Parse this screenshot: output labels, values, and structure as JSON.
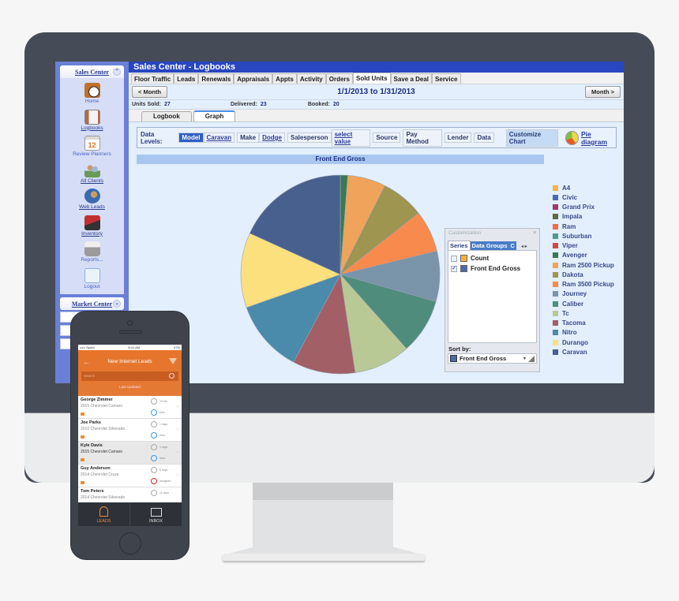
{
  "app": {
    "title": "Sales Center - Logbooks",
    "tabs": [
      "Floor Traffic",
      "Leads",
      "Renewals",
      "Appraisals",
      "Appts",
      "Activity",
      "Orders",
      "Sold Units",
      "Save a Deal",
      "Service"
    ],
    "active_tab": "Sold Units"
  },
  "sidebar": {
    "header": "Sales Center",
    "items": [
      {
        "label": "Home",
        "icon": "clock-calendar-icon",
        "color": "#c0702a"
      },
      {
        "label": "Logbooks",
        "icon": "book-icon",
        "color": "#b06a4a"
      },
      {
        "label": "Review Planners",
        "icon": "calendar-icon",
        "color": "#e7e7e7"
      },
      {
        "label": "All Clients",
        "icon": "people-icon",
        "color": "#6a9a5a"
      },
      {
        "label": "Web Leads",
        "icon": "globe-icon",
        "color": "#3a6ab0"
      },
      {
        "label": "Inventory",
        "icon": "car-icon",
        "color": "#c03030"
      },
      {
        "label": "Reports...",
        "icon": "printer-icon",
        "color": "#9a9a9a"
      },
      {
        "label": "Logout",
        "icon": "key-door-icon",
        "color": "#8ab0e0"
      }
    ],
    "market_header": "Market Center"
  },
  "period": {
    "prev_label": "< Month",
    "next_label": "Month >",
    "range": "1/1/2013 to 1/31/2013"
  },
  "stats": {
    "units_sold_label": "Units Sold:",
    "units_sold": "27",
    "delivered_label": "Delivered:",
    "delivered": "23",
    "booked_label": "Booked:",
    "booked": "20"
  },
  "subtabs": [
    "Logbook",
    "Graph"
  ],
  "active_subtab": "Graph",
  "toolbar": {
    "label": "Data Levels:",
    "model": "Model",
    "model_value": "Caravan",
    "make": "Make",
    "make_value": "Dodge",
    "salesperson": "Salesperson",
    "salesperson_value": "select value",
    "source": "Source",
    "pay_method": "Pay Method",
    "lender": "Lender",
    "data": "Data",
    "customize": "Customize Chart",
    "pie_diagram": "Pie diagram"
  },
  "customization": {
    "title": "Customization",
    "tabs": [
      "Series",
      "Data Groups",
      "C"
    ],
    "series": [
      {
        "label": "Count",
        "checked": false,
        "color": "#f5b041"
      },
      {
        "label": "Front End Gross",
        "checked": true,
        "color": "#4a6aa8"
      }
    ],
    "sort_by_label": "Sort by:",
    "sort_by_value": "Front End Gross"
  },
  "chart_data": {
    "type": "pie",
    "title": "Front End Gross",
    "legend_position": "right",
    "categories": [
      "A4",
      "Civic",
      "Grand Prix",
      "Impala",
      "Ram",
      "Suburban",
      "Viper",
      "Avenger",
      "Ram 2500 Pickup",
      "Dakota",
      "Ram 3500 Pickup",
      "Journey",
      "Caliber",
      "Tc",
      "Tacoma",
      "Nitro",
      "Durango",
      "Caravan"
    ],
    "colors": [
      "#f2b24d",
      "#4b6ab0",
      "#9e3a6a",
      "#5e6a48",
      "#e8704a",
      "#4e9a8e",
      "#d04848",
      "#3a7a52",
      "#f0a35a",
      "#9e9550",
      "#f98a4e",
      "#7a94aa",
      "#4f8c7c",
      "#b8c995",
      "#a26066",
      "#4a8aab",
      "#fbe07d",
      "#48608e"
    ],
    "values": [
      0,
      0,
      0,
      0,
      0,
      0,
      0,
      1.2,
      6.2,
      7.0,
      6.8,
      8.2,
      9.0,
      9.2,
      10.2,
      11.8,
      12.2,
      18.2
    ],
    "start_angle_deg": 0,
    "direction": "clockwise"
  },
  "phone": {
    "carrier": "••••• Sprint",
    "time": "8:41 AM",
    "battery": "97%",
    "header_title": "New Internet Leads",
    "search_placeholder": "Search",
    "sort_label": "Last Updated",
    "leads": [
      {
        "name": "George Zimmer",
        "vehicle": "2015 Chevrolet Camaro",
        "time1": "19 hrs",
        "status": "New",
        "status_color": "#3a9be0"
      },
      {
        "name": "Joe Parks",
        "vehicle": "2010 Chevrolet Silverado",
        "time1": "1 days",
        "status": "New",
        "status_color": "#3a9be0"
      },
      {
        "name": "Kyle Davis",
        "vehicle": "2015 Chevrolet Camaro",
        "time1": "1 days",
        "status": "New",
        "status_color": "#3a9be0"
      },
      {
        "name": "Guy Anderson",
        "vehicle": "2014 Chevrolet Cruze",
        "time1": "6 days",
        "status": "Assigned",
        "status_color": "#d22"
      },
      {
        "name": "Tom Peters",
        "vehicle": "2014 Chevrolet Silverado",
        "time1": "11 days",
        "status": "",
        "status_color": "#3a9be0"
      }
    ],
    "tabs": [
      "LEADS",
      "INBOX"
    ]
  }
}
